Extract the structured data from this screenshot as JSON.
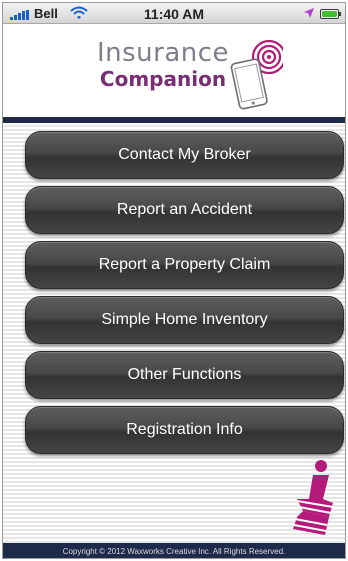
{
  "status_bar": {
    "carrier": "Bell",
    "time": "11:40 AM",
    "icons": [
      "signal-icon",
      "wifi-icon",
      "location-arrow-icon",
      "battery-icon"
    ],
    "battery_level": 1.0
  },
  "header": {
    "logo_line1": "Insurance",
    "logo_line2": "Companion",
    "logo_icon": "phone-signal-icon"
  },
  "menu": {
    "items": [
      {
        "label": "Contact My Broker"
      },
      {
        "label": "Report an Accident"
      },
      {
        "label": "Report a Property Claim"
      },
      {
        "label": "Simple Home Inventory"
      },
      {
        "label": "Other Functions"
      },
      {
        "label": "Registration Info"
      }
    ]
  },
  "footer": {
    "copyright": "Copyright © 2012 Waxworks Creative Inc. All Rights Reserved."
  },
  "colors": {
    "brand_purple": "#7a2d74",
    "brand_gray": "#7d7f8a",
    "accent_pink": "#b5197a",
    "navy": "#1e2a4a",
    "button_dark": "#484848"
  }
}
